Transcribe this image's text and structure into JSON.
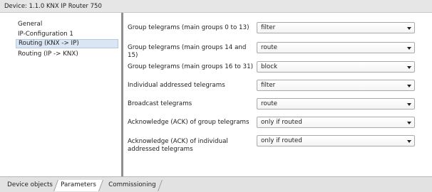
{
  "window": {
    "title": "Device: 1.1.0  KNX IP Router 750"
  },
  "sidebar": {
    "items": [
      {
        "label": "General"
      },
      {
        "label": "IP-Configuration 1"
      },
      {
        "label": "Routing (KNX -> IP)",
        "selected": true
      },
      {
        "label": "Routing (IP -> KNX)"
      }
    ]
  },
  "parameters": [
    {
      "label": "Group telegrams (main groups 0 to 13)",
      "value": "filter"
    },
    {
      "label": "Group telegrams (main groups 14 and 15)",
      "value": "route"
    },
    {
      "label": "Group telegrams (main groups 16 to 31)",
      "value": "block"
    },
    {
      "label": "Individual addressed telegrams",
      "value": "filter"
    },
    {
      "label": "Broadcast telegrams",
      "value": "route"
    },
    {
      "label": "Acknowledge (ACK) of group telegrams",
      "value": "only if routed"
    },
    {
      "label": "Acknowledge (ACK) of individual addressed telegrams",
      "value": "only if routed"
    }
  ],
  "tabs": [
    {
      "label": "Device objects"
    },
    {
      "label": "Parameters",
      "active": true
    },
    {
      "label": "Commissioning"
    }
  ],
  "colors": {
    "selection": "#dbe6f4",
    "divider": "#8f8f8f"
  }
}
